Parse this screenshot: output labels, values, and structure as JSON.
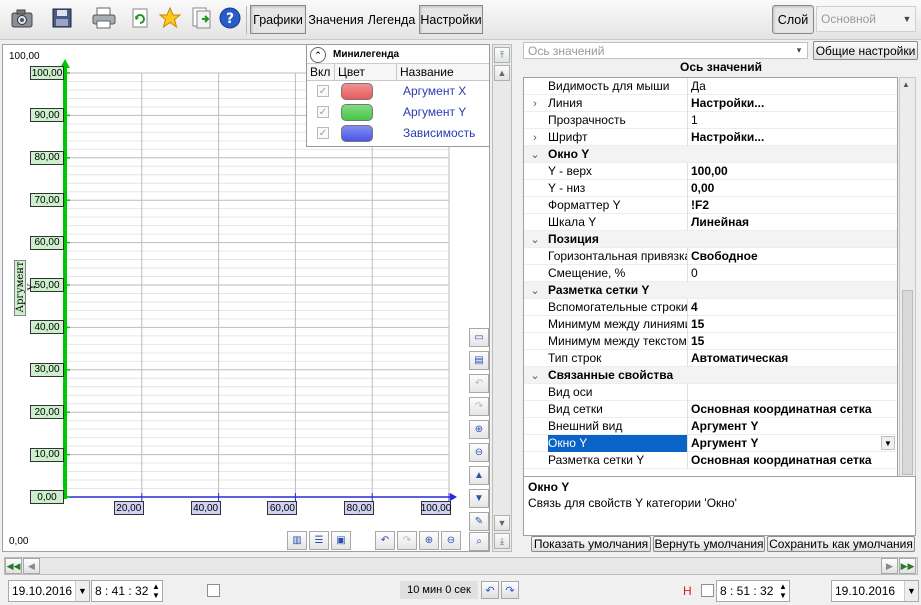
{
  "toolbar": {
    "buttons": {
      "charts": "Графики",
      "values": "Значения",
      "legend": "Легенда",
      "settings": "Настройки"
    },
    "layer_button": "Слой",
    "layer_select": "Основной"
  },
  "chart": {
    "ylabel": "Аргумент Y",
    "corner_top": "100,00",
    "corner_bottom": "0,00",
    "y_ticks": [
      "100,00",
      "90,00",
      "80,00",
      "70,00",
      "60,00",
      "50,00",
      "40,00",
      "30,00",
      "20,00",
      "10,00",
      "0,00"
    ],
    "x_ticks": [
      "20,00",
      "40,00",
      "60,00",
      "80,00",
      "100,00"
    ]
  },
  "chart_data": {
    "type": "line",
    "ylabel": "Аргумент Y",
    "ylim": [
      0,
      100
    ],
    "xlim": [
      0,
      100
    ],
    "y_ticks": [
      0,
      10,
      20,
      30,
      40,
      50,
      60,
      70,
      80,
      90,
      100
    ],
    "x_ticks": [
      20,
      40,
      60,
      80,
      100
    ],
    "grid": true,
    "series": [
      {
        "name": "Аргумент X",
        "values": []
      },
      {
        "name": "Аргумент Y",
        "values": []
      },
      {
        "name": "Зависимость",
        "values": []
      }
    ],
    "legend": "top-right"
  },
  "legend": {
    "title": "Минилегенда",
    "columns": {
      "on": "Вкл",
      "color": "Цвет",
      "name": "Название"
    },
    "items": [
      {
        "name": "Аргумент X",
        "color": "#e85a5a"
      },
      {
        "name": "Аргумент Y",
        "color": "#45c845"
      },
      {
        "name": "Зависимость",
        "color": "#4a55e8"
      }
    ]
  },
  "props": {
    "category_select": "Ось значений",
    "general_button": "Общие настройки",
    "title": "Ось значений",
    "rows": [
      {
        "type": "prop",
        "name": "Видимость для мыши",
        "value": "Да"
      },
      {
        "type": "prop",
        "name": "Линия",
        "value": "Настройки...",
        "bold": true,
        "expand": "›"
      },
      {
        "type": "prop",
        "name": "Прозрачность",
        "value": "1"
      },
      {
        "type": "prop",
        "name": "Шрифт",
        "value": "Настройки...",
        "bold": true,
        "expand": "›"
      },
      {
        "type": "cat",
        "name": "Окно Y"
      },
      {
        "type": "prop",
        "name": "Y - верх",
        "value": "100,00",
        "bold": true
      },
      {
        "type": "prop",
        "name": "Y - низ",
        "value": "0,00",
        "bold": true
      },
      {
        "type": "prop",
        "name": "Форматтер Y",
        "value": "!F2",
        "bold": true
      },
      {
        "type": "prop",
        "name": "Шкала Y",
        "value": "Линейная",
        "bold": true
      },
      {
        "type": "cat",
        "name": "Позиция"
      },
      {
        "type": "prop",
        "name": "Горизонтальная привязка",
        "value": "Свободное",
        "bold": true
      },
      {
        "type": "prop",
        "name": "Смещение, %",
        "value": "0"
      },
      {
        "type": "cat",
        "name": "Разметка сетки Y"
      },
      {
        "type": "prop",
        "name": "Вспомогательные строки",
        "value": "4",
        "bold": true
      },
      {
        "type": "prop",
        "name": "Минимум между линиями",
        "value": "15",
        "bold": true
      },
      {
        "type": "prop",
        "name": "Минимум между текстом",
        "value": "15",
        "bold": true
      },
      {
        "type": "prop",
        "name": "Тип строк",
        "value": "Автоматическая",
        "bold": true
      },
      {
        "type": "cat",
        "name": "Связанные свойства"
      },
      {
        "type": "prop",
        "name": "Вид оси",
        "value": ""
      },
      {
        "type": "prop",
        "name": "Вид сетки",
        "value": "Основная координатная сетка",
        "bold": true
      },
      {
        "type": "prop",
        "name": "Внешний вид",
        "value": "Аргумент Y",
        "bold": true
      },
      {
        "type": "prop",
        "name": "Окно Y",
        "value": "Аргумент Y",
        "bold": true,
        "selected": true
      },
      {
        "type": "prop",
        "name": "Разметка сетки Y",
        "value": "Основная координатная сетка",
        "bold": true
      }
    ],
    "description_title": "Окно Y",
    "description_text": "Связь для свойств Y категории 'Окно'",
    "buttons": {
      "show_defaults": "Показать умолчания",
      "restore_defaults": "Вернуть умолчания",
      "save_defaults": "Сохранить как умолчания"
    }
  },
  "bottom": {
    "date_start": "19.10.2016",
    "time_start": "8 : 41 : 32",
    "duration": "10 мин 0 сек",
    "h_label": "H",
    "time_end": "8 : 51 : 32",
    "date_end": "19.10.2016"
  },
  "colors": {
    "axis_y": "#00c800",
    "axis_x": "#2a2ad8",
    "grid": "#c8c8c8",
    "selection": "#0a64c8"
  }
}
